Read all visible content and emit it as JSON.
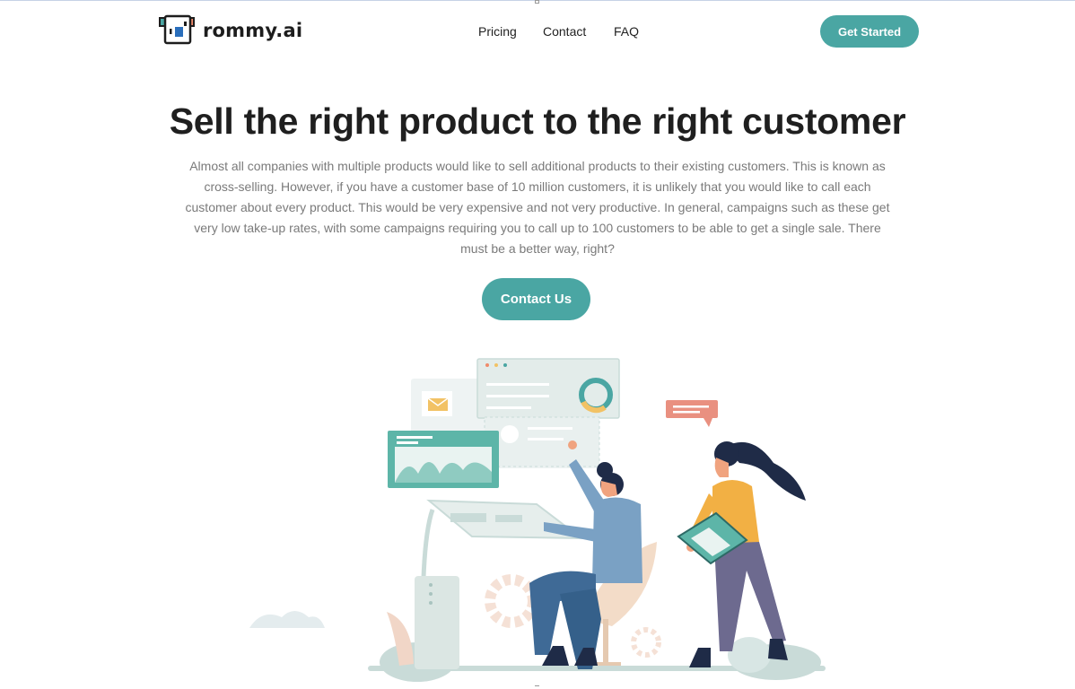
{
  "brand": {
    "name": "rommy.ai",
    "accent_color": "#4aa6a3"
  },
  "nav": {
    "items": [
      "Pricing",
      "Contact",
      "FAQ"
    ]
  },
  "header": {
    "cta_label": "Get Started"
  },
  "hero": {
    "title": "Sell the right product to the right customer",
    "body": "Almost all companies with multiple products would like to sell additional products to their existing customers. This is known as cross-selling. However, if you have a customer base of 10 million customers, it is unlikely that you would like to call each customer about every product. This would be very expensive and not very productive. In general, campaigns such as these get very low take-up rates, with some campaigns requiring you to call up to 100 customers to be able to get a single sale. There must be a better way, right?",
    "cta_label": "Contact Us"
  },
  "illustration": {
    "icon": "office-people-dashboard-illustration"
  }
}
